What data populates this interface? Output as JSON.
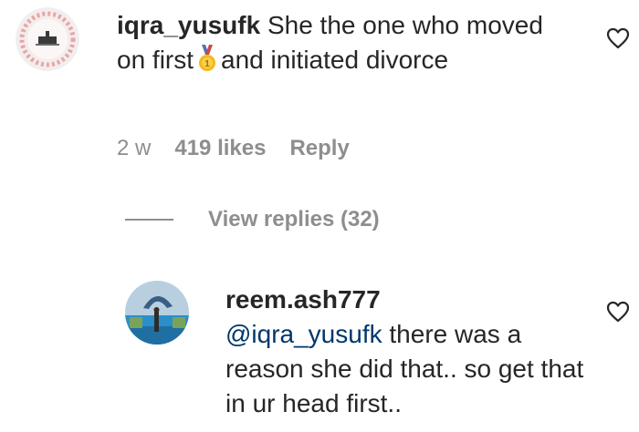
{
  "comment": {
    "username": "iqra_yusufk",
    "text_before_icon": "She the one who moved on first",
    "icon": "gold-medal-emoji",
    "text_after_icon": "and initiated divorce",
    "age": "2 w",
    "likes": "419 likes",
    "reply_label": "Reply"
  },
  "view_replies": {
    "label": "View replies (32)"
  },
  "reply": {
    "username": "reem.ash777",
    "mention": "@iqra_yusufk",
    "text": "there was a reason she did that.. so get that in ur head first.."
  },
  "colors": {
    "text": "#262626",
    "secondary": "#8e8e8e",
    "mention": "#00376b"
  }
}
